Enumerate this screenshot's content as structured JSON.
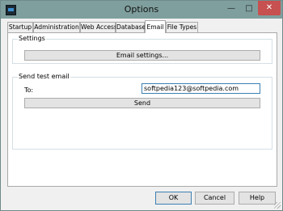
{
  "window": {
    "title": "Options",
    "minimize_glyph": "—",
    "maximize_glyph": "□",
    "close_glyph": "✕"
  },
  "tabs": [
    {
      "label": "Startup"
    },
    {
      "label": "Administration"
    },
    {
      "label": "Web Access"
    },
    {
      "label": "Database"
    },
    {
      "label": "Email",
      "active": true
    },
    {
      "label": "File Types"
    }
  ],
  "settings": {
    "group_label": "Settings",
    "email_settings_button": "Email settings..."
  },
  "test_email": {
    "group_label": "Send test email",
    "to_label": "To:",
    "to_value": "softpedia123@softpedia.com",
    "send_button": "Send"
  },
  "footer": {
    "ok_label": "OK",
    "cancel_label": "Cancel",
    "help_label": "Help"
  },
  "colors": {
    "titlebar": "#7f9f9e",
    "close_button": "#c75050",
    "focus_border": "#3c7fb1"
  }
}
